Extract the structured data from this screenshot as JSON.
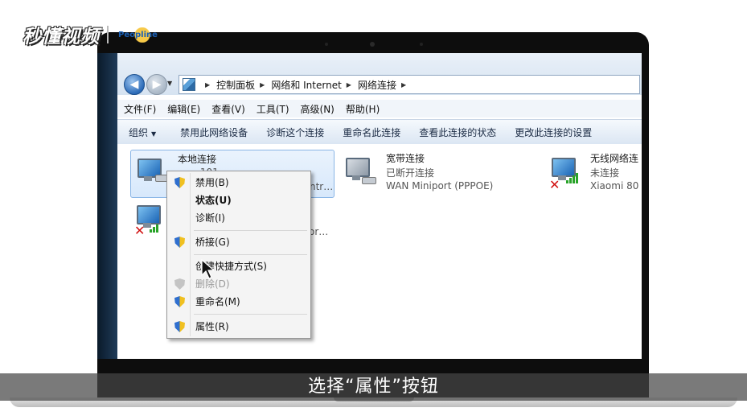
{
  "brand": {
    "name": "秒懂视频",
    "partner": "Peopline"
  },
  "address_bar": {
    "crumbs": [
      "控制面板",
      "网络和 Internet",
      "网络连接"
    ]
  },
  "menu_bar": {
    "items": [
      "文件(F)",
      "编辑(E)",
      "查看(V)",
      "工具(T)",
      "高级(N)",
      "帮助(H)"
    ]
  },
  "command_bar": {
    "organize": "组织",
    "items": [
      "禁用此网络设备",
      "诊断这个连接",
      "重命名此连接",
      "查看此连接的状态",
      "更改此连接的设置"
    ]
  },
  "connections": [
    {
      "name": "本地连接",
      "status": "…… 101",
      "device": "ntr…"
    },
    {
      "name": "宽带连接",
      "status": "已断开连接",
      "device": "WAN Miniport (PPPOE)"
    },
    {
      "name": "无线网络连",
      "status": "未连接",
      "device": "Xiaomi 80"
    },
    {
      "name": "",
      "status": "",
      "device": "or…"
    }
  ],
  "context_menu": {
    "items": [
      {
        "label": "禁用(B)",
        "icon": "shield-icon"
      },
      {
        "label": "状态(U)",
        "icon": ""
      },
      {
        "label": "诊断(I)",
        "icon": ""
      },
      {
        "label": "桥接(G)",
        "icon": "shield-icon"
      },
      {
        "label": "创建快捷方式(S)",
        "icon": ""
      },
      {
        "label": "删除(D)",
        "icon": "shield-icon-disabled"
      },
      {
        "label": "重命名(M)",
        "icon": "shield-icon"
      },
      {
        "label": "属性(R)",
        "icon": "shield-icon"
      }
    ]
  },
  "subtitle": "选择“属性”按钮",
  "colors": {
    "accent": "#2c6bb8",
    "selection": "#d7e8fb"
  }
}
